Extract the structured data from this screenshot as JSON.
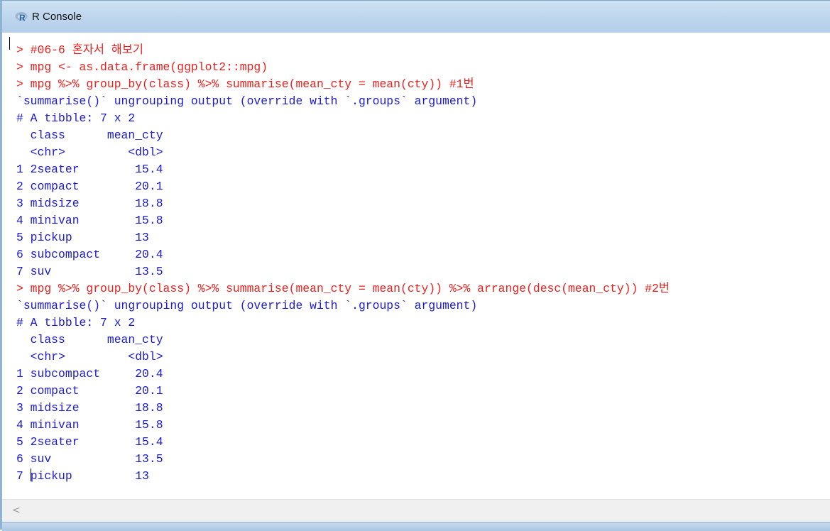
{
  "window": {
    "title": "R Console"
  },
  "console": {
    "lines": [
      {
        "kind": "cmd",
        "text": "> #06-6 혼자서 해보기"
      },
      {
        "kind": "cmd",
        "text": "> mpg <- as.data.frame(ggplot2::mpg)"
      },
      {
        "kind": "cmd",
        "text": "> mpg %>% group_by(class) %>% summarise(mean_cty = mean(cty)) #1번"
      },
      {
        "kind": "out",
        "text": "`summarise()` ungrouping output (override with `.groups` argument)"
      },
      {
        "kind": "out",
        "text": "# A tibble: 7 x 2"
      },
      {
        "kind": "out",
        "text": "  class      mean_cty"
      },
      {
        "kind": "out",
        "text": "  <chr>         <dbl>"
      },
      {
        "kind": "out",
        "text": "1 2seater        15.4"
      },
      {
        "kind": "out",
        "text": "2 compact        20.1"
      },
      {
        "kind": "out",
        "text": "3 midsize        18.8"
      },
      {
        "kind": "out",
        "text": "4 minivan        15.8"
      },
      {
        "kind": "out",
        "text": "5 pickup         13  "
      },
      {
        "kind": "out",
        "text": "6 subcompact     20.4"
      },
      {
        "kind": "out",
        "text": "7 suv            13.5"
      },
      {
        "kind": "cmd",
        "text": "> mpg %>% group_by(class) %>% summarise(mean_cty = mean(cty)) %>% arrange(desc(mean_cty)) #2번"
      },
      {
        "kind": "out",
        "text": "`summarise()` ungrouping output (override with `.groups` argument)"
      },
      {
        "kind": "out",
        "text": "# A tibble: 7 x 2"
      },
      {
        "kind": "out",
        "text": "  class      mean_cty"
      },
      {
        "kind": "out",
        "text": "  <chr>         <dbl>"
      },
      {
        "kind": "out",
        "text": "1 subcompact     20.4"
      },
      {
        "kind": "out",
        "text": "2 compact        20.1"
      },
      {
        "kind": "out",
        "text": "3 midsize        18.8"
      },
      {
        "kind": "out",
        "text": "4 minivan        15.8"
      },
      {
        "kind": "out",
        "text": "5 2seater        15.4"
      },
      {
        "kind": "out",
        "text": "6 suv            13.5"
      },
      {
        "kind": "out",
        "text": "7 pickup         13  "
      }
    ]
  },
  "scrollbar": {
    "left_arrow": "<"
  },
  "colors": {
    "command": "#e8201d",
    "output": "#1a1ad0",
    "titlebar": "#bcd4ec"
  },
  "icons": {
    "app": "r-logo-icon"
  }
}
